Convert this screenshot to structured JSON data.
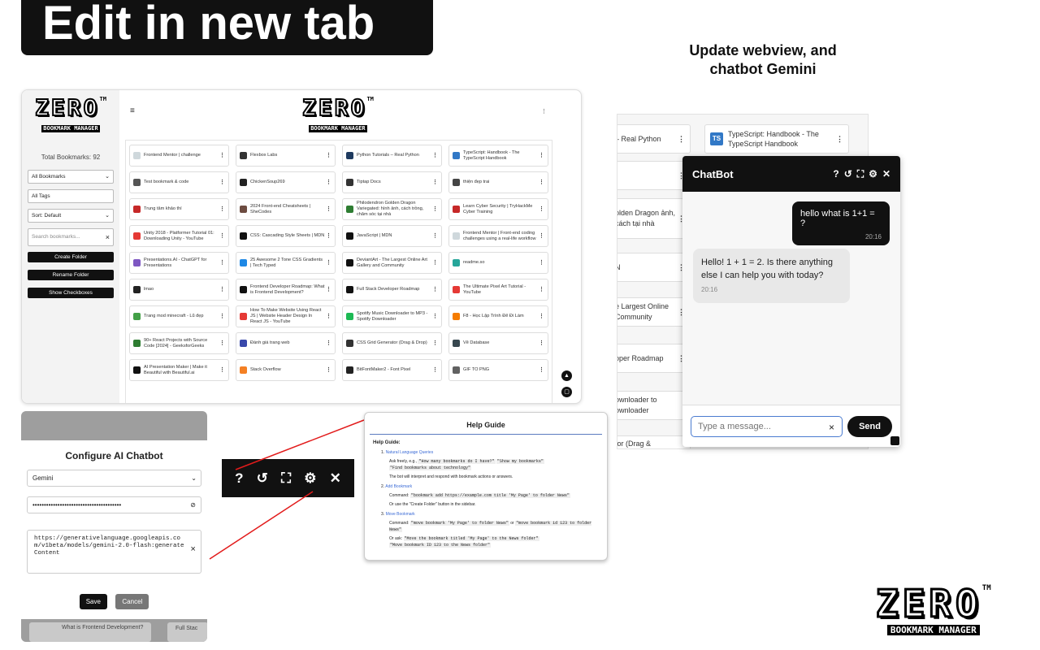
{
  "hero_title": "Edit in new tab",
  "update_heading": "Update webview, and chatbot Gemini",
  "logo": {
    "main": "ZERO",
    "sub": "BOOKMARK MANAGER",
    "tm": "TM"
  },
  "sidebar": {
    "total": "Total Bookmarks: 92",
    "folder_select": "All Bookmarks",
    "tags_input": "All Tags",
    "sort_select": "Sort: Default",
    "search_placeholder": "Search bookmarks...",
    "buttons": [
      "Create Folder",
      "Rename Folder",
      "Show Checkboxes"
    ]
  },
  "bookmarks": [
    {
      "title": "Frontend Mentor | challenge",
      "color": "#cfd8dc"
    },
    {
      "title": "Flexbox Labs",
      "color": "#333333"
    },
    {
      "title": "Python Tutorials – Real Python",
      "color": "#1e3a5f"
    },
    {
      "title": "TypeScript: Handbook - The TypeScript Handbook",
      "color": "#3178c6"
    },
    {
      "title": "Test bookmark & code",
      "color": "#555555"
    },
    {
      "title": "ChickenSoup269",
      "color": "#222222"
    },
    {
      "title": "Tiptap Docs",
      "color": "#333333"
    },
    {
      "title": "thiện đẹp trai",
      "color": "#444444"
    },
    {
      "title": "Trung tâm khảo thí",
      "color": "#c62828"
    },
    {
      "title": "2024 Front-end Cheatsheets | SheCodes",
      "color": "#6d4c41"
    },
    {
      "title": "Philodendron Golden Dragon Variegated: hình ảnh, cách trồng, chăm sóc tại nhà",
      "color": "#2e7d32"
    },
    {
      "title": "Learn Cyber Security | TryHackMe Cyber Training",
      "color": "#c62828"
    },
    {
      "title": "Unity 2018 - Platformer Tutorial 01: Downloading Unity - YouTube",
      "color": "#e53935"
    },
    {
      "title": "CSS: Cascading Style Sheets | MDN",
      "color": "#111111"
    },
    {
      "title": "JavaScript | MDN",
      "color": "#111111"
    },
    {
      "title": "Frontend Mentor | Front-end coding challenges using a real-life workflow",
      "color": "#cfd8dc"
    },
    {
      "title": "Presentations.AI - ChatGPT for Presentations",
      "color": "#7e57c2"
    },
    {
      "title": "25 Awesome 2 Tone CSS Gradients | Tech Typed",
      "color": "#1e88e5"
    },
    {
      "title": "DeviantArt - The Largest Online Art Gallery and Community",
      "color": "#111111"
    },
    {
      "title": "readme.so",
      "color": "#26a69a"
    },
    {
      "title": "lmao",
      "color": "#222222"
    },
    {
      "title": "Frontend Developer Roadmap: What is Frontend Development?",
      "color": "#111111"
    },
    {
      "title": "Full Stack Developer Roadmap",
      "color": "#111111"
    },
    {
      "title": "The Ultimate Pixel Art Tutorial - YouTube",
      "color": "#e53935"
    },
    {
      "title": "Trang mod minecraft - Lũ đẹp",
      "color": "#43a047"
    },
    {
      "title": "How To Make Website Using React JS | Website Header Design In React JS - YouTube",
      "color": "#e53935"
    },
    {
      "title": "Spotify Music Downloader to MP3 - Spotify Downloader",
      "color": "#1db954"
    },
    {
      "title": "F8 - Học Lập Trình Để Đi Làm",
      "color": "#f57c00"
    },
    {
      "title": "90+ React Projects with Source Code [2024] - GeeksforGeeks",
      "color": "#2e7d32"
    },
    {
      "title": "Đánh giá trang web",
      "color": "#3949ab"
    },
    {
      "title": "CSS Grid Generator (Drag & Drop)",
      "color": "#333333"
    },
    {
      "title": "Vẽ Database",
      "color": "#37474f"
    },
    {
      "title": "AI Presentation Maker | Make it Beautiful with Beautiful.ai",
      "color": "#111111"
    },
    {
      "title": "Stack Overflow",
      "color": "#f48024"
    },
    {
      "title": "BitFontMaker2 - Font Pixel",
      "color": "#222222"
    },
    {
      "title": "GIF TO PNG",
      "color": "#616161"
    }
  ],
  "chat_bg_items": [
    "– Real Python",
    "TypeScript: Handbook - The TypeScript Handbook",
    "olden Dragon ảnh, cách tại nhà",
    "N",
    "e Largest Online Community",
    "oper Roadmap",
    "ownloader to ownloader",
    "tor (Drag &"
  ],
  "chat": {
    "title": "ChatBot",
    "user_msg": "hello what is 1+1 = ?",
    "user_time": "20:16",
    "bot_msg": "Hello! 1 + 1 = 2. Is there anything else I can help you with today?",
    "bot_time": "20:16",
    "input_placeholder": "Type a message...",
    "send_label": "Send"
  },
  "config": {
    "title": "Configure AI Chatbot",
    "model": "Gemini",
    "api_key": "•••••••••••••••••••••••••••••••••••••••",
    "endpoint": "https://generativelanguage.googleapis.com/v1beta/models/gemini-2.0-flash:generateContent",
    "save_label": "Save",
    "cancel_label": "Cancel",
    "bg_item_left": "What is Frontend Development?",
    "bg_item_right": "Full Stac"
  },
  "help": {
    "title": "Help Guide",
    "section": "Help Guide:",
    "item1_title": "Natural Language Queries",
    "item1_ask": "Ask freely, e.g.,",
    "item1_code1": "\"How many bookmarks do I have?\"",
    "item1_code2": "\"Show my bookmarks\"",
    "item1_code3": "\"Find bookmarks about technology\"",
    "item1_note": "The bot will interpret and respond with bookmark actions or answers.",
    "item2_title": "Add Bookmark",
    "item2_cmd_label": "Command:",
    "item2_cmd": "\"bookmark add https://example.com title 'My Page' to folder News\"",
    "item2_note": "Or use the \"Create Folder\" button in the sidebar.",
    "item3_title": "Move Bookmark",
    "item3_cmd_label": "Command:",
    "item3_cmd": "\"move bookmark 'My Page' to folder News\"",
    "item3_or": "or",
    "item3_cmd2": "\"move bookmark id 123 to folder News\"",
    "item3_ask_label": "Or ask:",
    "item3_ask": "\"Move the bookmark titled 'My Page' to the News folder\"",
    "item3_ask2": "\"Move bookmark ID 123 to the News folder\""
  }
}
